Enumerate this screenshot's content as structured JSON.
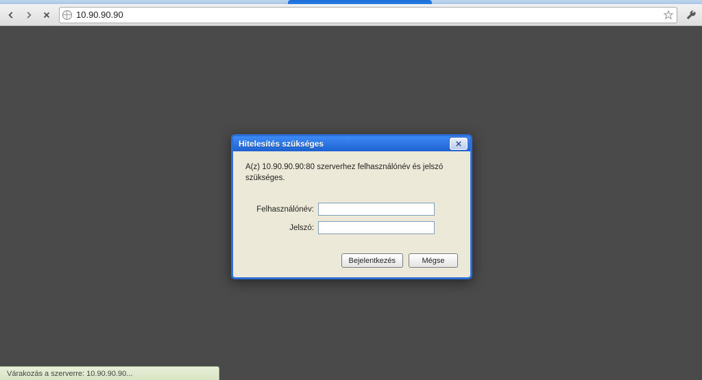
{
  "browser": {
    "address": "10.90.90.90"
  },
  "status": {
    "text": "Várakozás a szerverre: 10.90.90.90..."
  },
  "dialog": {
    "title": "Hitelesítés szükséges",
    "message": "A(z) 10.90.90.90:80 szerverhez felhasználónév és jelszó szükséges.",
    "username_label": "Felhasználónév:",
    "password_label": "Jelszó:",
    "username_value": "",
    "password_value": "",
    "login_label": "Bejelentkezés",
    "cancel_label": "Mégse"
  }
}
